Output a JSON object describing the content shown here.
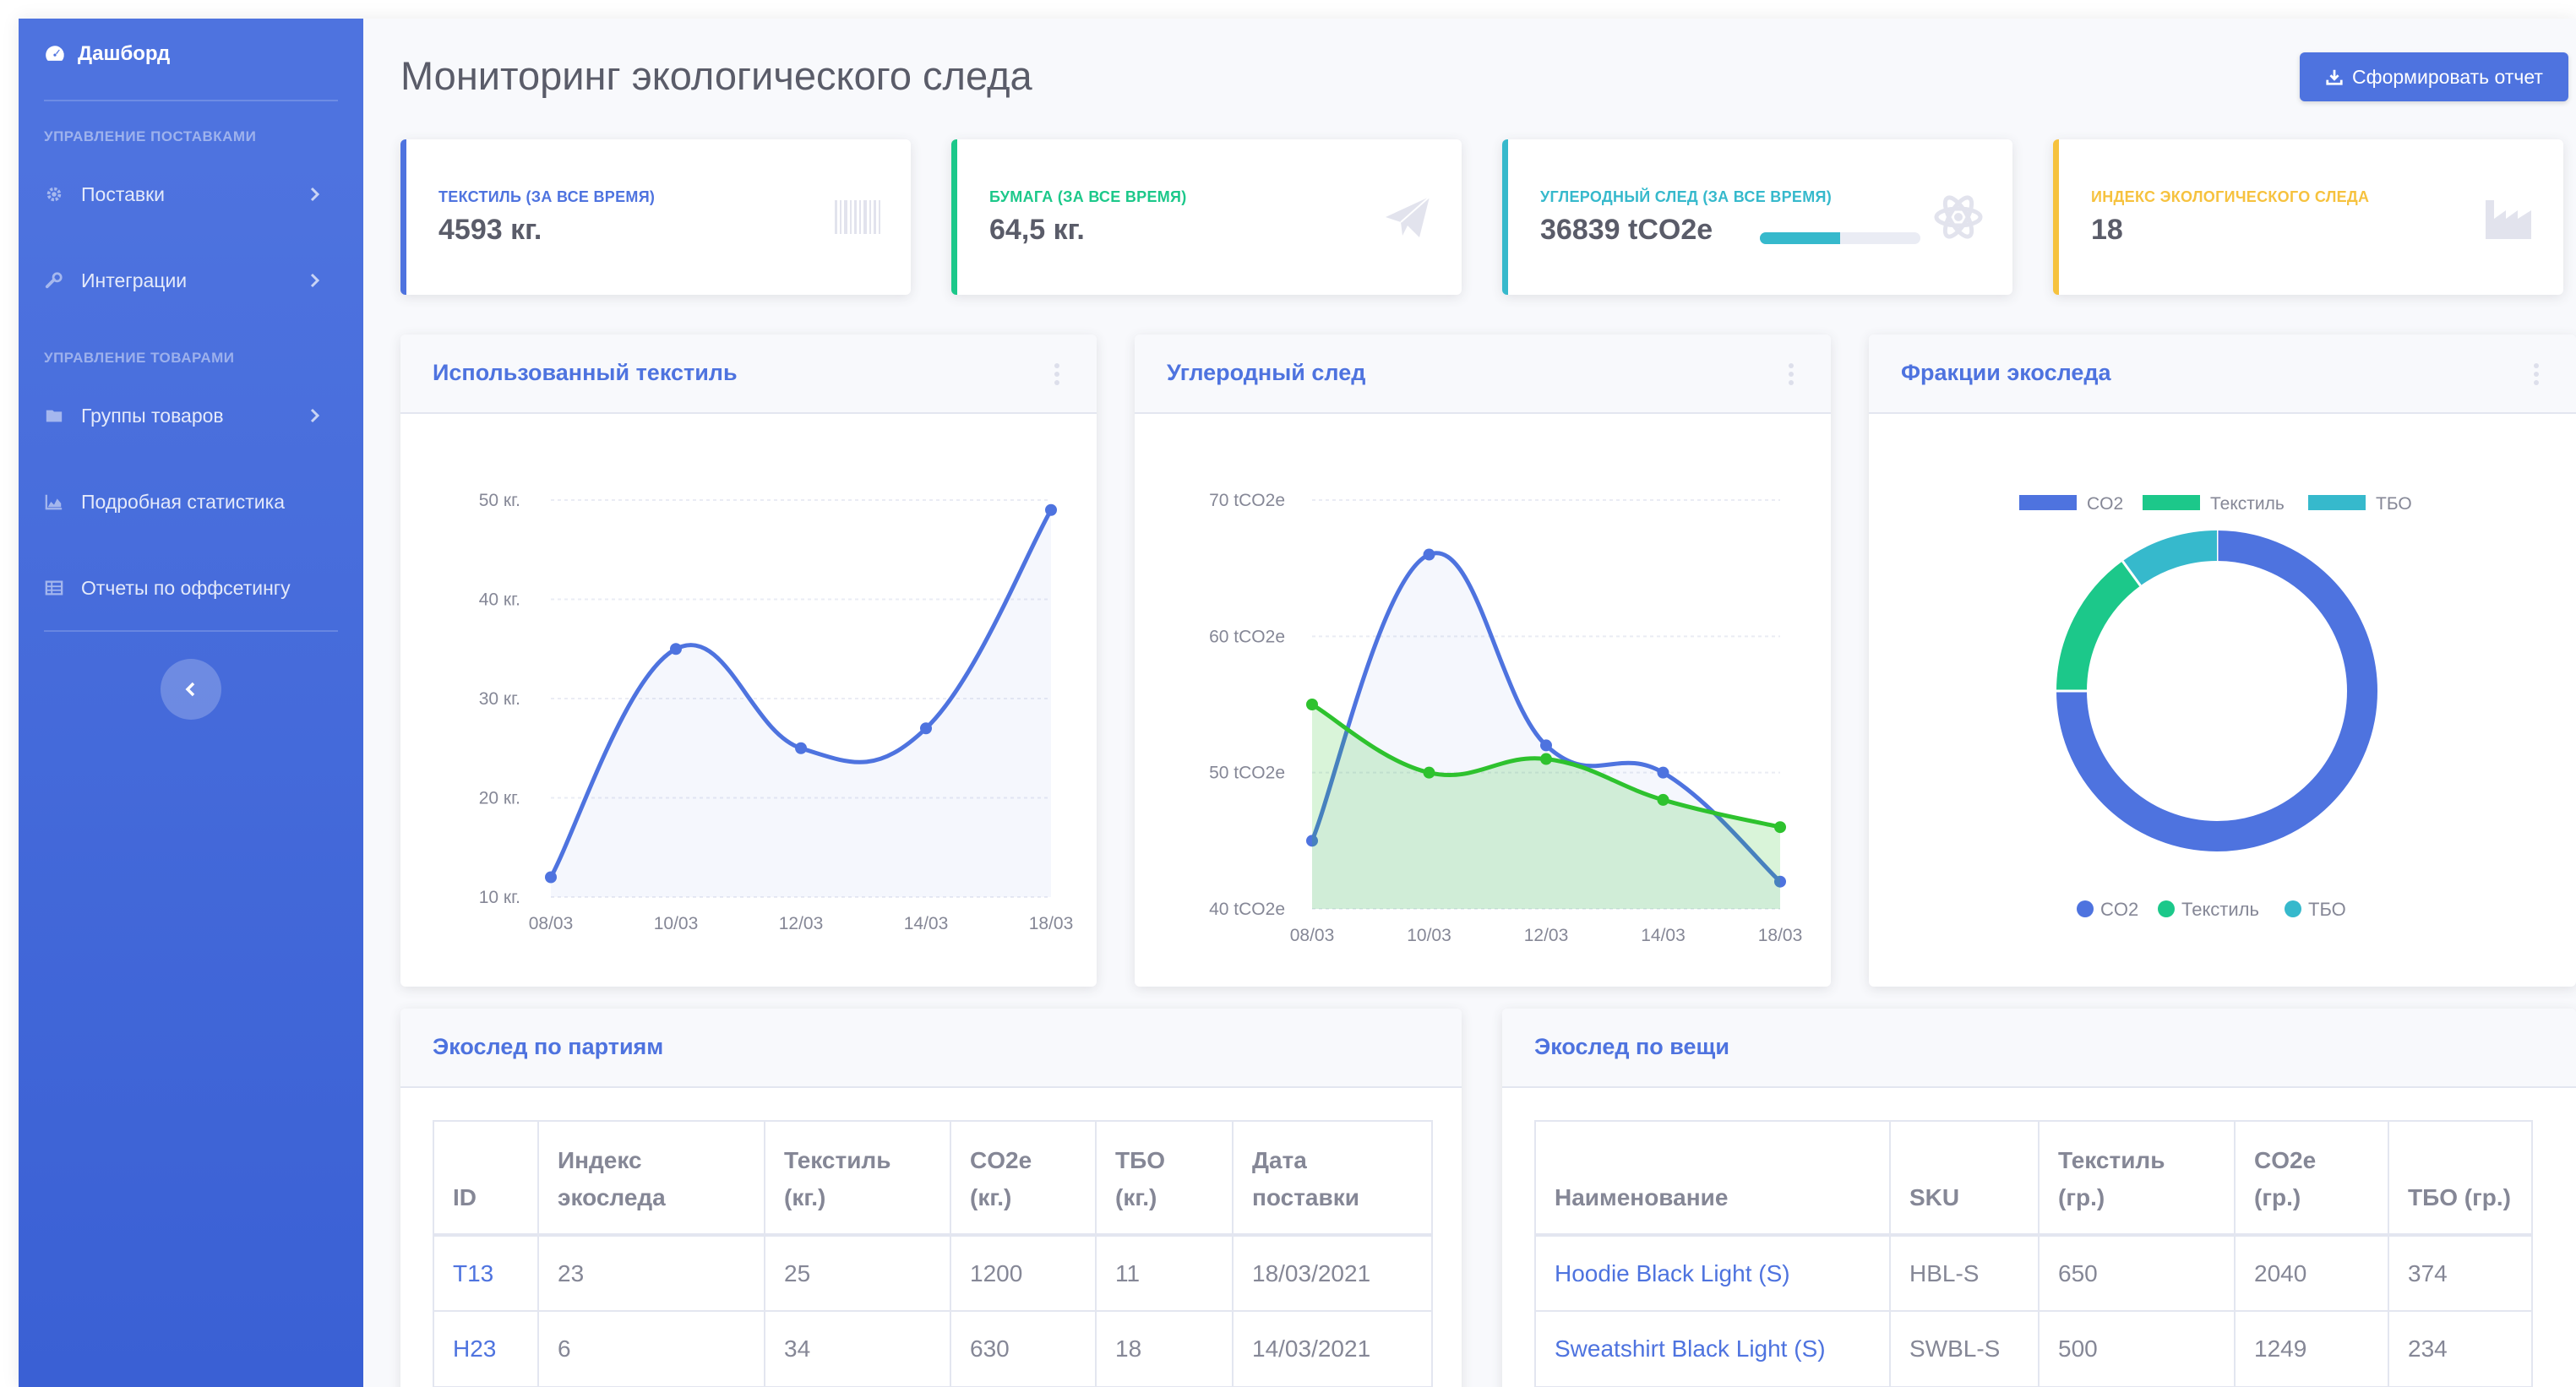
{
  "sidebar": {
    "brand": "Дашборд",
    "section1": "Управление поставками",
    "section2": "Управление товарами",
    "items": [
      {
        "label": "Поставки",
        "icon": "gear-icon"
      },
      {
        "label": "Интеграции",
        "icon": "wrench-icon"
      },
      {
        "label": "Группы товаров",
        "icon": "folder-icon"
      },
      {
        "label": "Подробная статистика",
        "icon": "area-chart-icon"
      },
      {
        "label": "Отчеты по оффсетингу",
        "icon": "table-icon"
      }
    ]
  },
  "header": {
    "title": "Мониторинг экологического следа",
    "report_button": "Сформировать отчет"
  },
  "stats": [
    {
      "label": "Текстиль (за все время)",
      "value": "4593 кг.",
      "color": "#4e73df",
      "icon": "barcode-icon"
    },
    {
      "label": "Бумага (за все время)",
      "value": "64,5 кг.",
      "color": "#1cc88a",
      "icon": "paper-plane-icon"
    },
    {
      "label": "Углеродный след (за все время)",
      "value": "36839 tCO2e",
      "color": "#36b9cc",
      "icon": "atom-icon",
      "progress": 0.5
    },
    {
      "label": "Индекс экологического следа",
      "value": "18",
      "color": "#f6c23e",
      "icon": "industry-icon"
    }
  ],
  "panels": {
    "textile_title": "Использованный текстиль",
    "carbon_title": "Углеродный след",
    "fractions_title": "Фракции экоследа",
    "batches_title": "Экослед по партиям",
    "items_title": "Экослед по вещи"
  },
  "chart_data": [
    {
      "type": "area",
      "title": "Использованный текстиль",
      "categories": [
        "08/03",
        "10/03",
        "12/03",
        "14/03",
        "18/03"
      ],
      "series": [
        {
          "values": [
            12,
            35,
            25,
            27,
            49
          ]
        }
      ],
      "yticks": [
        "10 кг.",
        "20 кг.",
        "30 кг.",
        "40 кг.",
        "50 кг."
      ],
      "ylim": [
        10,
        50
      ],
      "grid": true
    },
    {
      "type": "area",
      "title": "Углеродный след",
      "categories": [
        "08/03",
        "10/03",
        "12/03",
        "14/03",
        "18/03"
      ],
      "series": [
        {
          "values": [
            45,
            66,
            52,
            50,
            42
          ],
          "color": "#4e73df"
        },
        {
          "values": [
            55,
            50,
            51,
            48,
            46
          ],
          "color": "#2ec22e"
        }
      ],
      "yticks": [
        "40 tCO2e",
        "50 tCO2e",
        "60 tCO2e",
        "70 tCO2e"
      ],
      "ylim": [
        40,
        70
      ],
      "grid": true
    },
    {
      "type": "pie",
      "title": "Фракции экоследа",
      "labels": [
        "CO2",
        "Текстиль",
        "ТБО"
      ],
      "values": [
        75,
        15,
        10
      ],
      "colors": [
        "#4e73df",
        "#1cc88a",
        "#36b9cc"
      ],
      "legend": "top and bottom"
    }
  ],
  "batches": {
    "headers": [
      "ID",
      "Индекс экоследа",
      "Текстиль (кг.)",
      "CO2e (кг.)",
      "ТБО (кг.)",
      "Дата поставки"
    ],
    "rows": [
      [
        "T13",
        "23",
        "25",
        "1200",
        "11",
        "18/03/2021"
      ],
      [
        "H23",
        "6",
        "34",
        "630",
        "18",
        "14/03/2021"
      ]
    ]
  },
  "items": {
    "headers": [
      "Наименование",
      "SKU",
      "Текстиль (гр.)",
      "CO2e (гр.)",
      "ТБО (гр.)"
    ],
    "rows": [
      [
        "Hoodie Black Light (S)",
        "HBL-S",
        "650",
        "2040",
        "374"
      ],
      [
        "Sweatshirt Black Light (S)",
        "SWBL-S",
        "500",
        "1249",
        "234"
      ]
    ]
  }
}
